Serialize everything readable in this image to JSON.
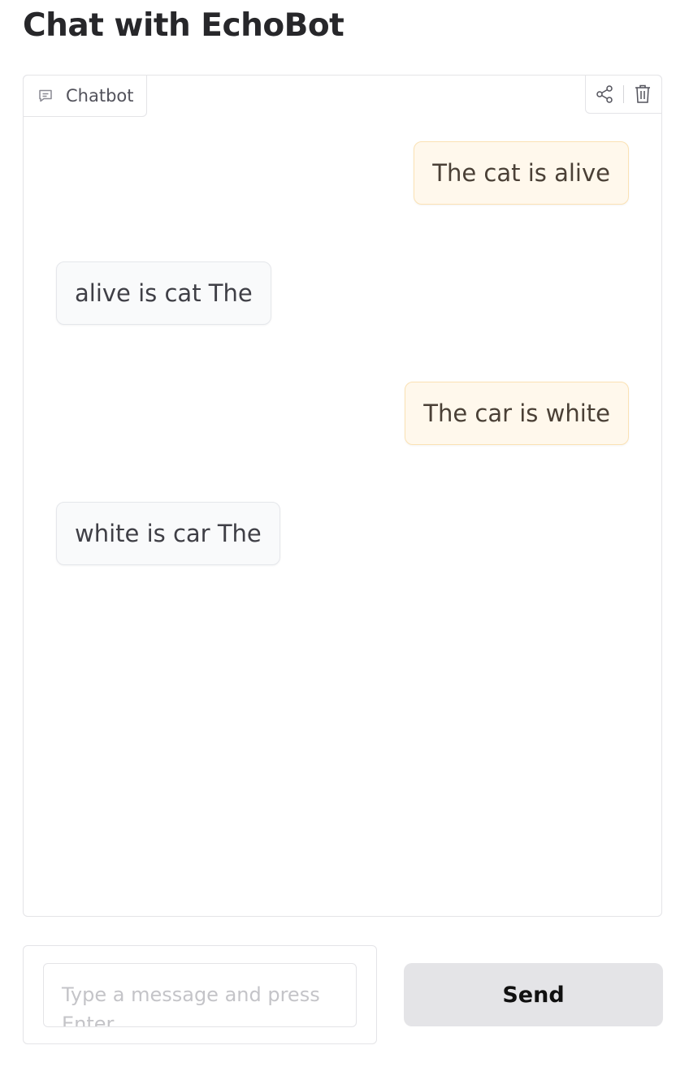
{
  "page": {
    "title": "Chat with EchoBot"
  },
  "chatbot": {
    "label": "Chatbot",
    "label_icon": "chat-bubble-icon",
    "tools": [
      {
        "name": "share",
        "icon": "share-icon"
      },
      {
        "name": "clear",
        "icon": "trash-icon"
      }
    ],
    "messages": [
      {
        "role": "user",
        "text": "The cat is alive"
      },
      {
        "role": "bot",
        "text": "alive is cat The"
      },
      {
        "role": "user",
        "text": "The car is white"
      },
      {
        "role": "bot",
        "text": "white is car The"
      }
    ]
  },
  "input": {
    "placeholder": "Type a message and press Enter",
    "value": ""
  },
  "send_button": {
    "label": "Send"
  },
  "colors": {
    "user_bubble_bg": "#fff8ec",
    "user_bubble_border": "#fbe2b4",
    "bot_bubble_bg": "#f9fafb",
    "bot_bubble_border": "#e5e7eb",
    "send_button_bg": "#e4e4e7"
  }
}
